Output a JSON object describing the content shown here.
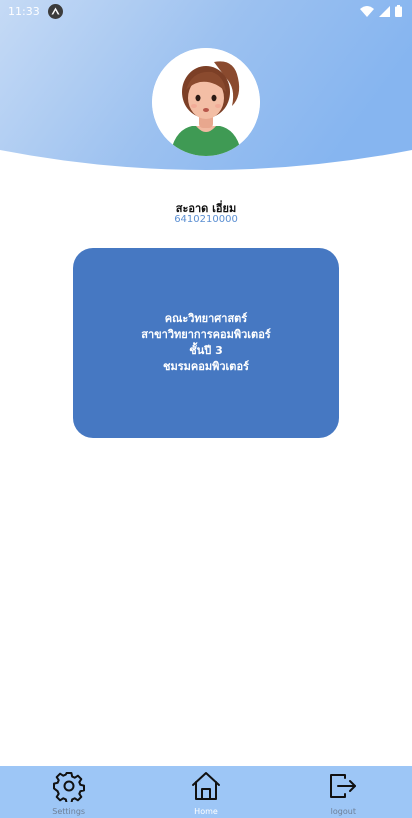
{
  "status_bar": {
    "time": "11:33"
  },
  "profile": {
    "name": "สะอาด เอี่ยม",
    "student_id": "6410210000"
  },
  "info_card": {
    "lines": [
      "คณะวิทยาศาสตร์",
      "สาขาวิทยาการคอมพิวเตอร์",
      "ชั้นปี 3",
      "ชมรมคอมพิวเตอร์"
    ]
  },
  "colors": {
    "header_gradient_start": "#b9d2f3",
    "header_gradient_end": "#8ab7ef",
    "card_bg": "#4678c2",
    "nav_bg": "#9dc6f6"
  },
  "bottom_nav": {
    "items": [
      {
        "label": "Settings",
        "icon": "gear-icon",
        "active": false
      },
      {
        "label": "Home",
        "icon": "home-icon",
        "active": true
      },
      {
        "label": "logout",
        "icon": "logout-icon",
        "active": false
      }
    ]
  }
}
